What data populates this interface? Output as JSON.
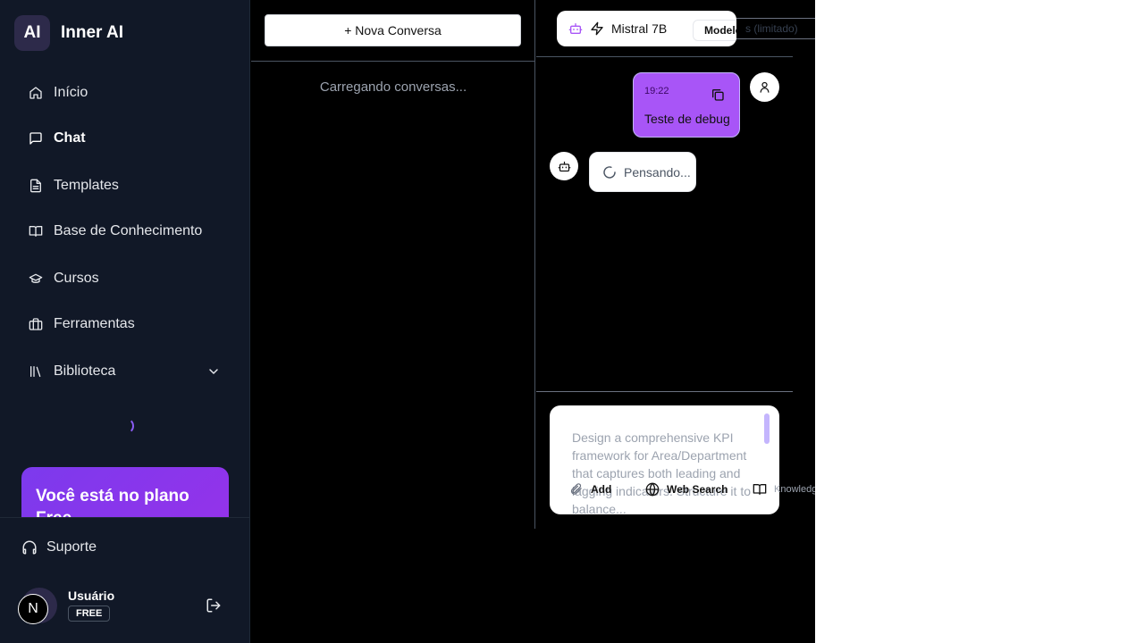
{
  "app": {
    "brand_logo": "AI",
    "brand_name": "Inner AI"
  },
  "sidebar": {
    "items": [
      {
        "label": "Início",
        "icon": "home-icon"
      },
      {
        "label": "Chat",
        "icon": "message-icon",
        "active": true
      },
      {
        "label": "Templates",
        "icon": "file-icon"
      },
      {
        "label": "Base de Conhecimento",
        "icon": "book-icon"
      },
      {
        "label": "Cursos",
        "icon": "graduation-cap-icon"
      },
      {
        "label": "Ferramentas",
        "icon": "briefcase-icon"
      },
      {
        "label": "Biblioteca",
        "icon": "library-icon"
      }
    ],
    "plan_card_text": "Você está no plano Free",
    "support_label": "Suporte",
    "user": {
      "avatar_letter": "N",
      "name": "Usuário",
      "plan": "FREE"
    }
  },
  "conversations": {
    "new_button": "+ Nova Conversa",
    "loading_text": "Carregando conversas..."
  },
  "chat": {
    "model_name": "Mistral 7B",
    "models_tag": "Modelos Rápidos",
    "models_rest": "s (limitado)",
    "messages": [
      {
        "role": "user",
        "time": "19:22",
        "text": "Teste de debug"
      }
    ],
    "thinking_text": "Pensando...",
    "composer_placeholder": "Design a comprehensive KPI framework for Area/Department that captures both leading and lagging indicators. Structure it to balance...",
    "tools": {
      "add": "Add",
      "web_search": "Web Search",
      "knowledge": "Knowledge"
    }
  },
  "colors": {
    "accent": "#a855f7",
    "sidebar_bg": "#111827",
    "main_bg": "#000000",
    "plan_card": "#7c3aed"
  }
}
